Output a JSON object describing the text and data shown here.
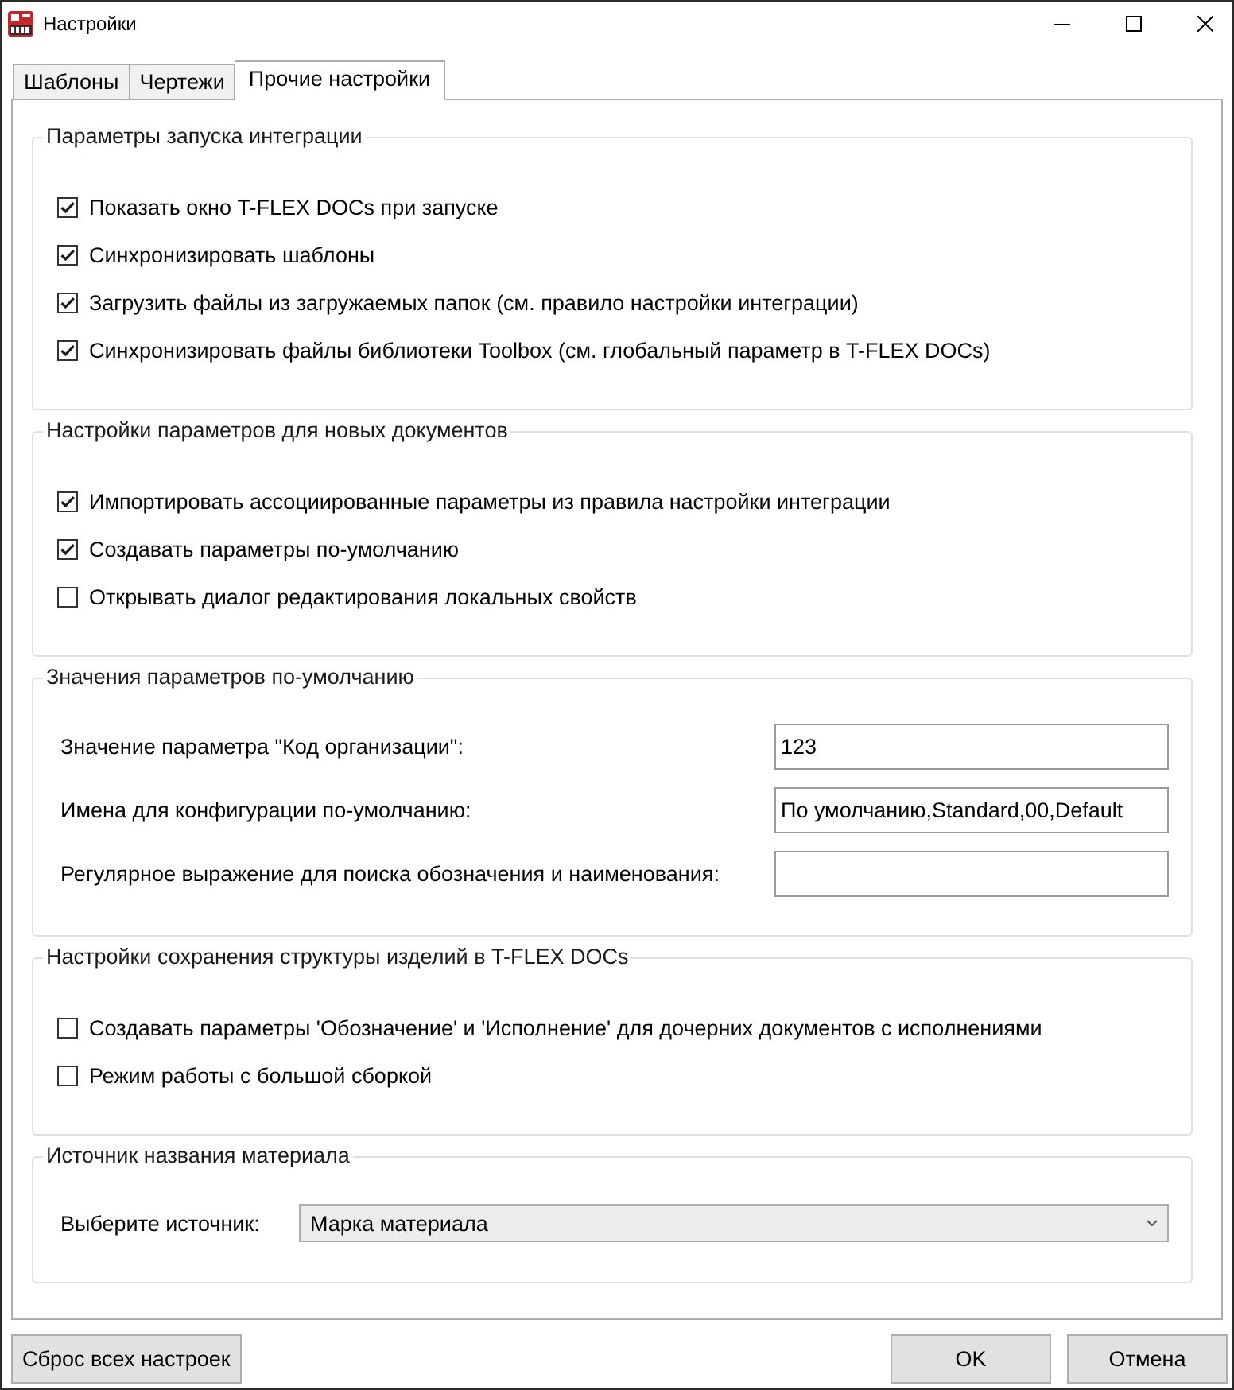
{
  "window": {
    "title": "Настройки"
  },
  "tabs": [
    {
      "label": "Шаблоны",
      "selected": false
    },
    {
      "label": "Чертежи",
      "selected": false
    },
    {
      "label": "Прочие настройки",
      "selected": true
    }
  ],
  "groups": [
    {
      "kind": "checkboxes",
      "title": "Параметры запуска интеграции",
      "items": [
        {
          "label": "Показать окно T-FLEX DOCs при запуске",
          "checked": true
        },
        {
          "label": "Синхронизировать шаблоны",
          "checked": true
        },
        {
          "label": "Загрузить файлы из загружаемых папок (см. правило настройки интеграции)",
          "checked": true
        },
        {
          "label": "Синхронизировать файлы библиотеки Toolbox (см. глобальный параметр в T-FLEX DOCs)",
          "checked": true
        }
      ]
    },
    {
      "kind": "checkboxes",
      "title": "Настройки параметров для новых документов",
      "items": [
        {
          "label": "Импортировать ассоциированные параметры из правила настройки интеграции",
          "checked": true
        },
        {
          "label": "Создавать параметры по-умолчанию",
          "checked": true
        },
        {
          "label": "Открывать диалог редактирования локальных свойств",
          "checked": false
        }
      ]
    },
    {
      "kind": "fields",
      "title": "Значения параметров по-умолчанию",
      "fields": [
        {
          "label": "Значение параметра \"Код организации\":",
          "value": "123"
        },
        {
          "label": "Имена для конфигурации по-умолчанию:",
          "value": "По умолчанию,Standard,00,Default"
        },
        {
          "label": "Регулярное выражение для поиска обозначения и наименования:"
        }
      ]
    },
    {
      "kind": "checkboxes",
      "title": "Настройки сохранения структуры изделий в T-FLEX DOCs",
      "items": [
        {
          "label": "Создавать параметры 'Обозначение' и 'Исполнение' для дочерних документов с исполнениями",
          "checked": false
        },
        {
          "label": "Режим работы с большой сборкой",
          "checked": false
        }
      ]
    },
    {
      "kind": "dropdown",
      "title": "Источник названия материала",
      "label": "Выберите источник:",
      "value": "Марка материала"
    }
  ],
  "footer": {
    "left_buttons": [
      "Сброс всех настроек"
    ],
    "right_buttons": [
      "OK",
      "Отмена"
    ]
  }
}
